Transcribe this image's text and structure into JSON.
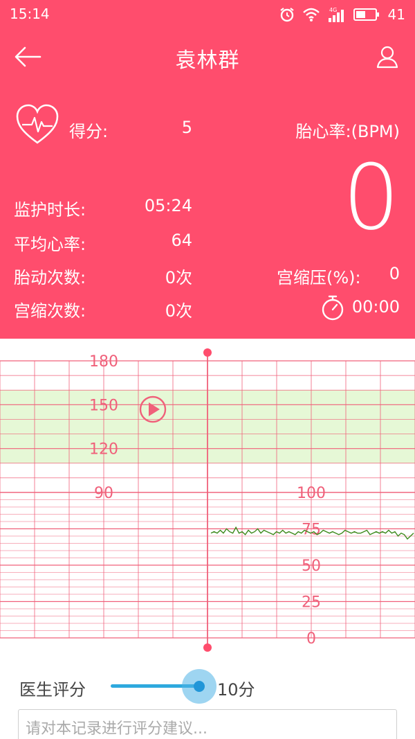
{
  "status_bar": {
    "time": "15:14",
    "network": "4G",
    "battery": "41"
  },
  "nav": {
    "title": "袁林群"
  },
  "stats": {
    "score_label": "得分:",
    "score_value": "5",
    "fhr_label": "胎心率:(BPM)",
    "fhr_value": "0",
    "duration_label": "监护时长:",
    "duration_value": "05:24",
    "avg_hr_label": "平均心率:",
    "avg_hr_value": "64",
    "movement_label": "胎动次数:",
    "movement_value": "0次",
    "uc_pressure_label": "宫缩压(%):",
    "uc_pressure_value": "0",
    "contraction_label": "宫缩次数:",
    "contraction_value": "0次",
    "timer_value": "00:00"
  },
  "chart_data": {
    "type": "line",
    "fhr_axis": {
      "ticks": [
        180,
        150,
        120,
        90
      ],
      "normal_range": [
        110,
        160
      ]
    },
    "toco_axis": {
      "ticks": [
        100,
        75,
        50,
        25,
        0
      ]
    },
    "toco_series": {
      "values": [
        72,
        73,
        72,
        74,
        72,
        75,
        73,
        72,
        76,
        72,
        73,
        71,
        74,
        72,
        73,
        75,
        72,
        74,
        73,
        72,
        71,
        73,
        72,
        74,
        72,
        73,
        72,
        71,
        73,
        72,
        74,
        73,
        72,
        73,
        71,
        72,
        74,
        73,
        72,
        73,
        72,
        71,
        72,
        74,
        73,
        72,
        73,
        72,
        72,
        73,
        74,
        71,
        72,
        73,
        72,
        73,
        72,
        74,
        72,
        73,
        70,
        72,
        71,
        68,
        70,
        72
      ]
    },
    "colors": {
      "grid": "#f0607a",
      "normal_band": "#e6f8d6",
      "toco_line": "#3d8a1c",
      "labels": "#f0607a"
    }
  },
  "score": {
    "label": "医生评分",
    "value": "10分",
    "level": 1.0
  },
  "comment": {
    "placeholder": "请对本记录进行评分建议..."
  },
  "icons": {
    "back": "arrow-left-icon",
    "profile": "person-icon",
    "heart": "heart-pulse-icon",
    "timer": "stopwatch-icon",
    "play": "play-icon"
  }
}
